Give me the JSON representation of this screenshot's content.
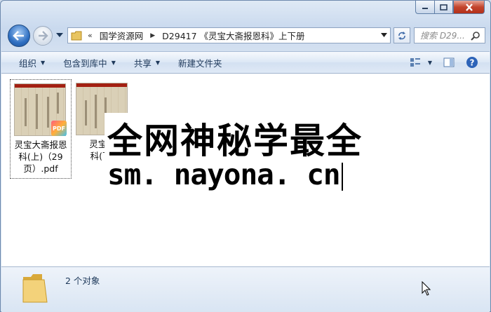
{
  "window": {
    "buttons": {
      "minimize": "minimize",
      "maximize": "maximize",
      "close": "close"
    }
  },
  "nav": {
    "address": {
      "overflow_chevron": "«",
      "crumbs": [
        "国学资源网",
        "D29417 《灵宝大斋报恩科》上下册"
      ]
    },
    "search": {
      "placeholder": "搜索 D29..."
    }
  },
  "command_bar": {
    "organize": "组织",
    "include_in_library": "包含到库中",
    "share": "共享",
    "new_folder": "新建文件夹"
  },
  "files": [
    {
      "name": "灵宝大斋报恩科(上)（29页）.pdf",
      "label_lines": [
        "灵宝大斋报恩",
        "科(上)（29",
        "页）.pdf"
      ],
      "badge": "PDF",
      "selected": true
    },
    {
      "name": "灵宝大斋报恩科(下)",
      "label_lines": [
        "灵宝大",
        "科(下)"
      ],
      "badge": "",
      "selected": false
    }
  ],
  "watermark": {
    "line1": "全网神秘学最全",
    "line2": "sm. nayona. cn"
  },
  "details": {
    "count_text": "2 个对象"
  },
  "colors": {
    "accent": "#1e395b",
    "close_red": "#c3452d",
    "back_blue": "#2e6fc2",
    "pdf_cover_red": "#a32012"
  }
}
